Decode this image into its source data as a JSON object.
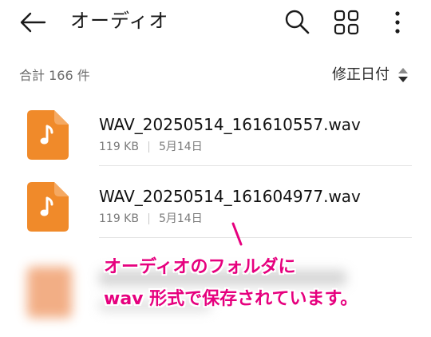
{
  "appbar": {
    "title": "オーディオ",
    "back_icon": "back-arrow-icon",
    "search_icon": "search-icon",
    "grid_icon": "grid-view-icon",
    "more_icon": "more-vert-icon"
  },
  "subheader": {
    "count_label": "合計 166 件",
    "sort_label": "修正日付",
    "sort_icon": "sort-arrows-icon"
  },
  "files": [
    {
      "name": "WAV_20250514_161610557.wav",
      "size": "119 KB",
      "date": "5月14日",
      "icon": "music-note-file-icon"
    },
    {
      "name": "WAV_20250514_161604977.wav",
      "size": "119 KB",
      "date": "5月14日",
      "icon": "music-note-file-icon"
    }
  ],
  "annotation": {
    "line1": "オーディオのフォルダに",
    "line2": "wav 形式で保存されています。",
    "color": "#e6007e"
  },
  "colors": {
    "file_icon": "#f08a2a",
    "accent": "#e6007e"
  }
}
